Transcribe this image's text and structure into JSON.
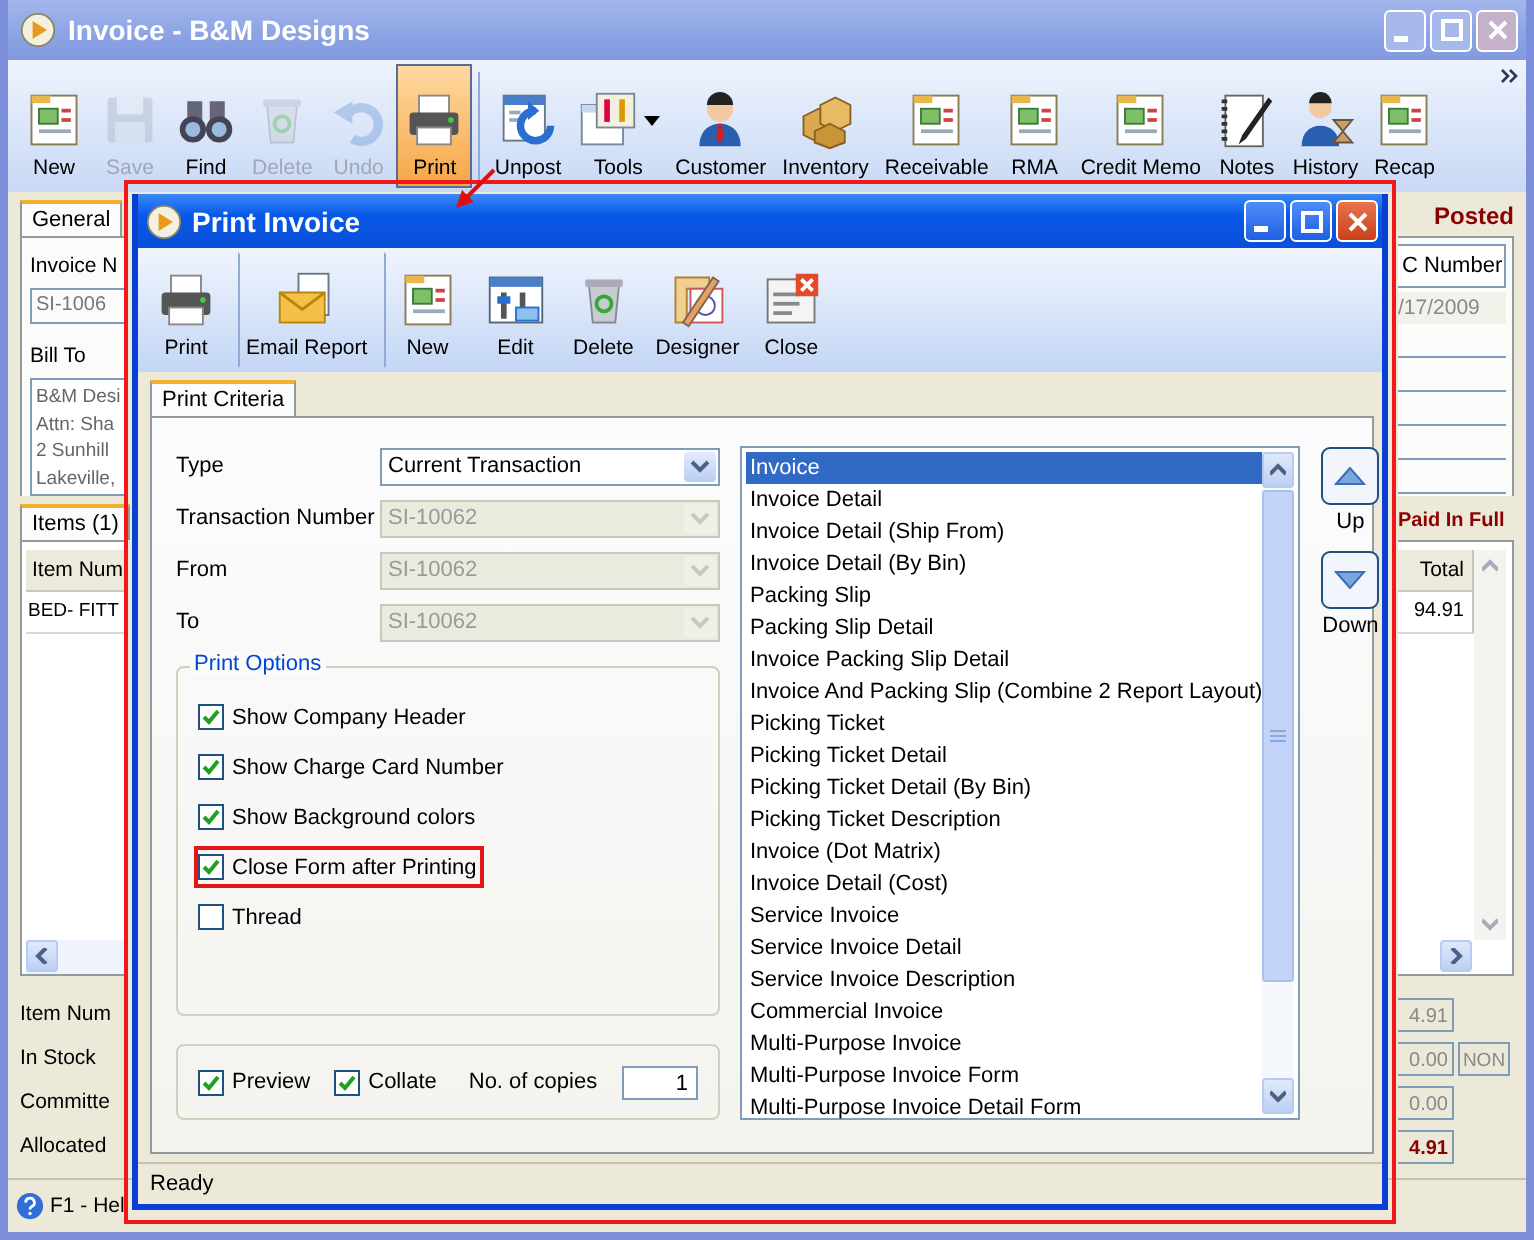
{
  "window": {
    "title": "Invoice - B&M Designs"
  },
  "toolbar": {
    "items": [
      {
        "label": "New",
        "disabled": false,
        "selected": false,
        "dropdown": false,
        "separator_before": false
      },
      {
        "label": "Save",
        "disabled": true,
        "selected": false,
        "dropdown": false,
        "separator_before": false
      },
      {
        "label": "Find",
        "disabled": false,
        "selected": false,
        "dropdown": false,
        "separator_before": false
      },
      {
        "label": "Delete",
        "disabled": true,
        "selected": false,
        "dropdown": false,
        "separator_before": false
      },
      {
        "label": "Undo",
        "disabled": true,
        "selected": false,
        "dropdown": false,
        "separator_before": false
      },
      {
        "label": "Print",
        "disabled": false,
        "selected": true,
        "dropdown": false,
        "separator_before": false
      },
      {
        "label": "Unpost",
        "disabled": false,
        "selected": false,
        "dropdown": false,
        "separator_before": true
      },
      {
        "label": "Tools",
        "disabled": false,
        "selected": false,
        "dropdown": true,
        "separator_before": false
      },
      {
        "label": "Customer",
        "disabled": false,
        "selected": false,
        "dropdown": false,
        "separator_before": false
      },
      {
        "label": "Inventory",
        "disabled": false,
        "selected": false,
        "dropdown": false,
        "separator_before": false
      },
      {
        "label": "Receivable",
        "disabled": false,
        "selected": false,
        "dropdown": false,
        "separator_before": false
      },
      {
        "label": "RMA",
        "disabled": false,
        "selected": false,
        "dropdown": false,
        "separator_before": false
      },
      {
        "label": "Credit Memo",
        "disabled": false,
        "selected": false,
        "dropdown": false,
        "separator_before": false
      },
      {
        "label": "Notes",
        "disabled": false,
        "selected": false,
        "dropdown": false,
        "separator_before": false
      },
      {
        "label": "History",
        "disabled": false,
        "selected": false,
        "dropdown": false,
        "separator_before": false
      },
      {
        "label": "Recap",
        "disabled": false,
        "selected": false,
        "dropdown": false,
        "separator_before": false
      }
    ]
  },
  "left_panel": {
    "tabs": [
      {
        "label": "General",
        "selected": true
      }
    ],
    "invoice_label": "Invoice N",
    "invoice_value": "SI-1006",
    "bill_to_label": "Bill To",
    "bill_to_lines": [
      "B&M Desi",
      "Attn: Sha",
      "2 Sunhill",
      "Lakeville,"
    ],
    "items_tab": "Items (1)",
    "items_header": "Item Num",
    "items_row": "BED- FITT",
    "summary_labels": [
      "Item Num",
      "In Stock",
      "Committe",
      "Allocated"
    ]
  },
  "right_panel": {
    "status": "Posted",
    "column_header": "C Number",
    "date": "/17/2009",
    "payment_status": "Paid In Full",
    "total_header": "Total",
    "total_value": "94.91",
    "summary_values": [
      {
        "value": "4.91",
        "bold": false
      },
      {
        "value": "0.00",
        "bold": false,
        "code": "NON"
      },
      {
        "value": "0.00",
        "bold": false
      },
      {
        "value": "4.91",
        "bold": true
      }
    ]
  },
  "status_bar": {
    "help": "F1 - Hel"
  },
  "dialog": {
    "title": "Print Invoice",
    "toolbar": [
      {
        "label": "Print",
        "separator_before": false
      },
      {
        "label": "Email Report",
        "separator_before": true
      },
      {
        "label": "New",
        "separator_before": true
      },
      {
        "label": "Edit",
        "separator_before": false
      },
      {
        "label": "Delete",
        "separator_before": false
      },
      {
        "label": "Designer",
        "separator_before": false
      },
      {
        "label": "Close",
        "separator_before": false
      }
    ],
    "tab": {
      "label": "Print Criteria",
      "selected": true
    },
    "fields": [
      {
        "label": "Type",
        "value": "Current Transaction",
        "disabled": false
      },
      {
        "label": "Transaction Number",
        "value": "SI-10062",
        "disabled": true
      },
      {
        "label": "From",
        "value": "SI-10062",
        "disabled": true
      },
      {
        "label": "To",
        "value": "SI-10062",
        "disabled": true
      }
    ],
    "options_title": "Print Options",
    "options": [
      {
        "label": "Show Company Header",
        "checked": true,
        "highlighted": false
      },
      {
        "label": "Show Charge Card Number",
        "checked": true,
        "highlighted": false
      },
      {
        "label": "Show Background colors",
        "checked": true,
        "highlighted": false
      },
      {
        "label": "Close Form after Printing",
        "checked": true,
        "highlighted": true
      },
      {
        "label": "Thread",
        "checked": false,
        "highlighted": false
      }
    ],
    "output_options": [
      {
        "label": "Preview",
        "checked": true
      },
      {
        "label": "Collate",
        "checked": true
      }
    ],
    "copies_label": "No. of copies",
    "copies_value": "1",
    "reports": [
      {
        "label": "Invoice",
        "selected": true
      },
      {
        "label": "Invoice Detail",
        "selected": false
      },
      {
        "label": "Invoice Detail (Ship From)",
        "selected": false
      },
      {
        "label": "Invoice Detail (By Bin)",
        "selected": false
      },
      {
        "label": "Packing Slip",
        "selected": false
      },
      {
        "label": "Packing Slip Detail",
        "selected": false
      },
      {
        "label": "Invoice Packing Slip Detail",
        "selected": false
      },
      {
        "label": "Invoice And Packing Slip (Combine 2 Report Layout)",
        "selected": false
      },
      {
        "label": "Picking Ticket",
        "selected": false
      },
      {
        "label": "Picking Ticket Detail",
        "selected": false
      },
      {
        "label": "Picking Ticket Detail (By Bin)",
        "selected": false
      },
      {
        "label": "Picking Ticket Description",
        "selected": false
      },
      {
        "label": "Invoice (Dot Matrix)",
        "selected": false
      },
      {
        "label": "Invoice Detail (Cost)",
        "selected": false
      },
      {
        "label": "Service Invoice",
        "selected": false
      },
      {
        "label": "Service Invoice Detail",
        "selected": false
      },
      {
        "label": "Service Invoice Description",
        "selected": false
      },
      {
        "label": "Commercial Invoice",
        "selected": false
      },
      {
        "label": "Multi-Purpose Invoice",
        "selected": false
      },
      {
        "label": "Multi-Purpose Invoice Form",
        "selected": false
      },
      {
        "label": "Multi-Purpose Invoice Detail Form",
        "selected": false
      }
    ],
    "move_buttons": [
      "Up",
      "Down"
    ],
    "status": "Ready"
  },
  "callout": {
    "frame": true,
    "arrow": true
  }
}
